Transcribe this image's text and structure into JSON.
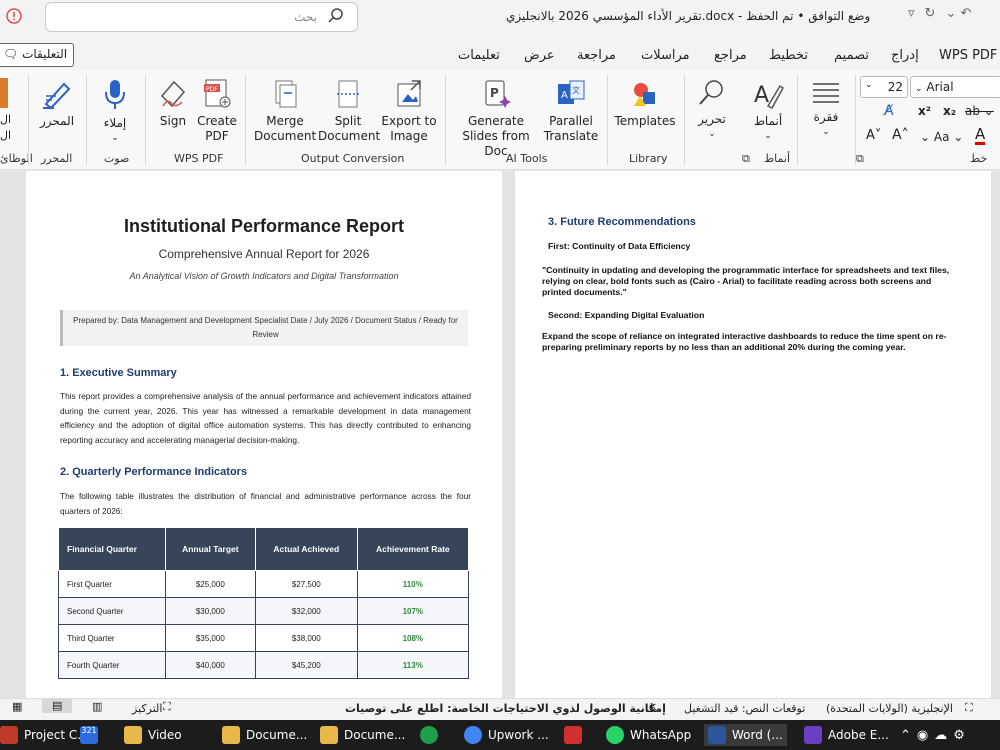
{
  "titlebar": {
    "search_placeholder": "بحث",
    "doc_title": "تقرير الأداء المؤسسي 2026 بالانجليزي.docx  -  وضع التوافق • تم الحفظ"
  },
  "tabs": [
    "WPS PDF",
    "إدراج",
    "تصميم",
    "تخطيط",
    "مراجع",
    "مراسلات",
    "مراجعة",
    "عرض",
    "تعليمات"
  ],
  "comments_label": "التعليقات",
  "ribbon": {
    "editor_label": "المحرر",
    "dictate_label": "إملاء",
    "sign_label": "Sign",
    "create_pdf_label": "Create PDF",
    "merge_label": "Merge Document",
    "split_label": "Split Document",
    "export_label": "Export to Image",
    "generate_label": "Generate Slides from Doc",
    "translate_label": "Parallel Translate",
    "templates_label": "Templates",
    "edit_label": "تحرير",
    "styles_label": "أنماط",
    "paragraph_label": "فقرة",
    "font_name": "Arial",
    "font_size": "22",
    "groups": {
      "editor": "المحرر",
      "voice": "صوت",
      "wps_pdf": "WPS PDF",
      "output": "Output Conversion",
      "ai": "AI Tools",
      "library": "Library",
      "styles": "أنماط",
      "font": "خط"
    },
    "left_cut_1": "ال",
    "left_cut_2": "ال",
    "left_cut_3": "الوظائ"
  },
  "page1": {
    "title": "Institutional Performance Report",
    "subtitle": "Comprehensive Annual Report for 2026",
    "tagline": "An Analytical Vision of Growth Indicators and Digital Transformation",
    "prepared": "Prepared by: Data Management and Development Specialist  Date / July 2026 / Document Status / Ready for Review",
    "h1": "1. Executive Summary",
    "summary": "This report provides a comprehensive analysis of the annual performance and achievement indicators attained during the current year, 2026. This year has witnessed a remarkable development in data management efficiency and the adoption of digital office automation systems. This has directly contributed to enhancing reporting accuracy and accelerating managerial decision-making.",
    "h2": "2. Quarterly Performance Indicators",
    "table_intro": "The following table illustrates the distribution of financial and administrative performance across the four quarters of 2026:",
    "table": {
      "headers": [
        "Financial Quarter",
        "Annual Target",
        "Actual Achieved",
        "Achievement Rate"
      ],
      "rows": [
        [
          "First Quarter",
          "$25,000",
          "$27,500",
          "110%"
        ],
        [
          "Second Quarter",
          "$30,000",
          "$32,000",
          "107%"
        ],
        [
          "Third Quarter",
          "$35,000",
          "$38,000",
          "108%"
        ],
        [
          "Fourth Quarter",
          "$40,000",
          "$45,200",
          "113%"
        ]
      ]
    }
  },
  "page2": {
    "h3": "3. Future Recommendations",
    "first": "First: Continuity of Data Efficiency",
    "quote": "\"Continuity in updating and developing the programmatic interface for spreadsheets and text files, relying on clear, bold fonts such as (Cairo - Arial) to facilitate reading across both screens and printed documents.\"",
    "second": "Second: Expanding Digital Evaluation",
    "expand": "Expand the scope of reliance on integrated interactive dashboards to reduce the time spent on re-preparing preliminary reports by no less than an additional 20% during the coming year."
  },
  "status": {
    "language": "الإنجليزية (الولايات المتحدة)",
    "predictions": "توقعات النص: قيد التشغيل",
    "accessibility": "إمكانية الوصول لذوي الاحتياجات الخاصة: اطلع على توصيات",
    "focus": "التركيز"
  },
  "taskbar": [
    {
      "label": "Project C...",
      "color": "#c0392b"
    },
    {
      "label": "",
      "color": "#2d6cdf"
    },
    {
      "label": "Video",
      "color": "#e8b84a"
    },
    {
      "label": "Docume...",
      "color": "#e8b84a"
    },
    {
      "label": "Docume...",
      "color": "#e8b84a"
    },
    {
      "label": "",
      "color": "#1e9e4b"
    },
    {
      "label": "Upwork ...",
      "color": "#4285f4"
    },
    {
      "label": "",
      "color": "#d32f2f"
    },
    {
      "label": "WhatsApp",
      "color": "#25d366"
    },
    {
      "label": "Word (...",
      "color": "#2b579a"
    },
    {
      "label": "Adobe E...",
      "color": "#6a3fc1"
    }
  ]
}
